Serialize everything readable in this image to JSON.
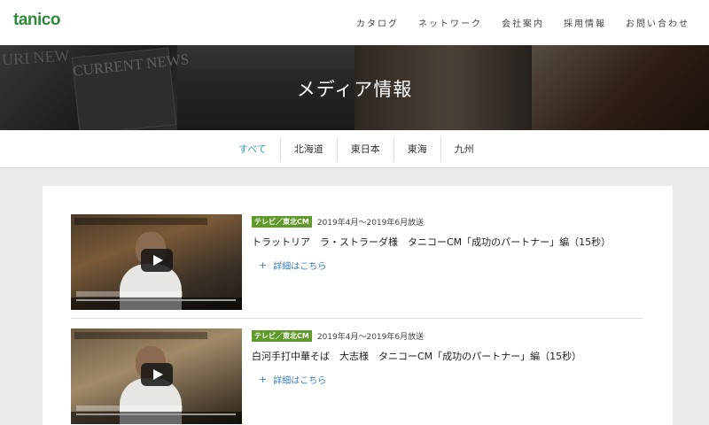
{
  "header": {
    "logo": "tanico",
    "nav": [
      "カタログ",
      "ネットワーク",
      "会社案内",
      "採用情報",
      "お問い合わせ"
    ]
  },
  "hero": {
    "title": "メディア情報",
    "magazine_text": "CURRENT NEWS",
    "magazine_text2": "URI NEW"
  },
  "filters": {
    "tabs": [
      "すべて",
      "北海道",
      "東日本",
      "東海",
      "九州"
    ],
    "active": "すべて"
  },
  "media_items": [
    {
      "badge": "テレビ／東北CM",
      "date": "2019年4月～2019年6月放送",
      "title": "トラットリア　ラ・ストラーダ様　タニコーCM「成功のパートナー」編（15秒）",
      "more_label": "詳細はこちら"
    },
    {
      "badge": "テレビ／東北CM",
      "date": "2019年4月～2019年6月放送",
      "title": "白河手打中華そば　大志様　タニコーCM「成功のパートナー」編（15秒）",
      "more_label": "詳細はこちら"
    }
  ],
  "colors": {
    "brand": "#2f8a3c",
    "tab_active": "#3aa0b2",
    "badge": "#5f9a2b",
    "link": "#3a7fc1"
  }
}
